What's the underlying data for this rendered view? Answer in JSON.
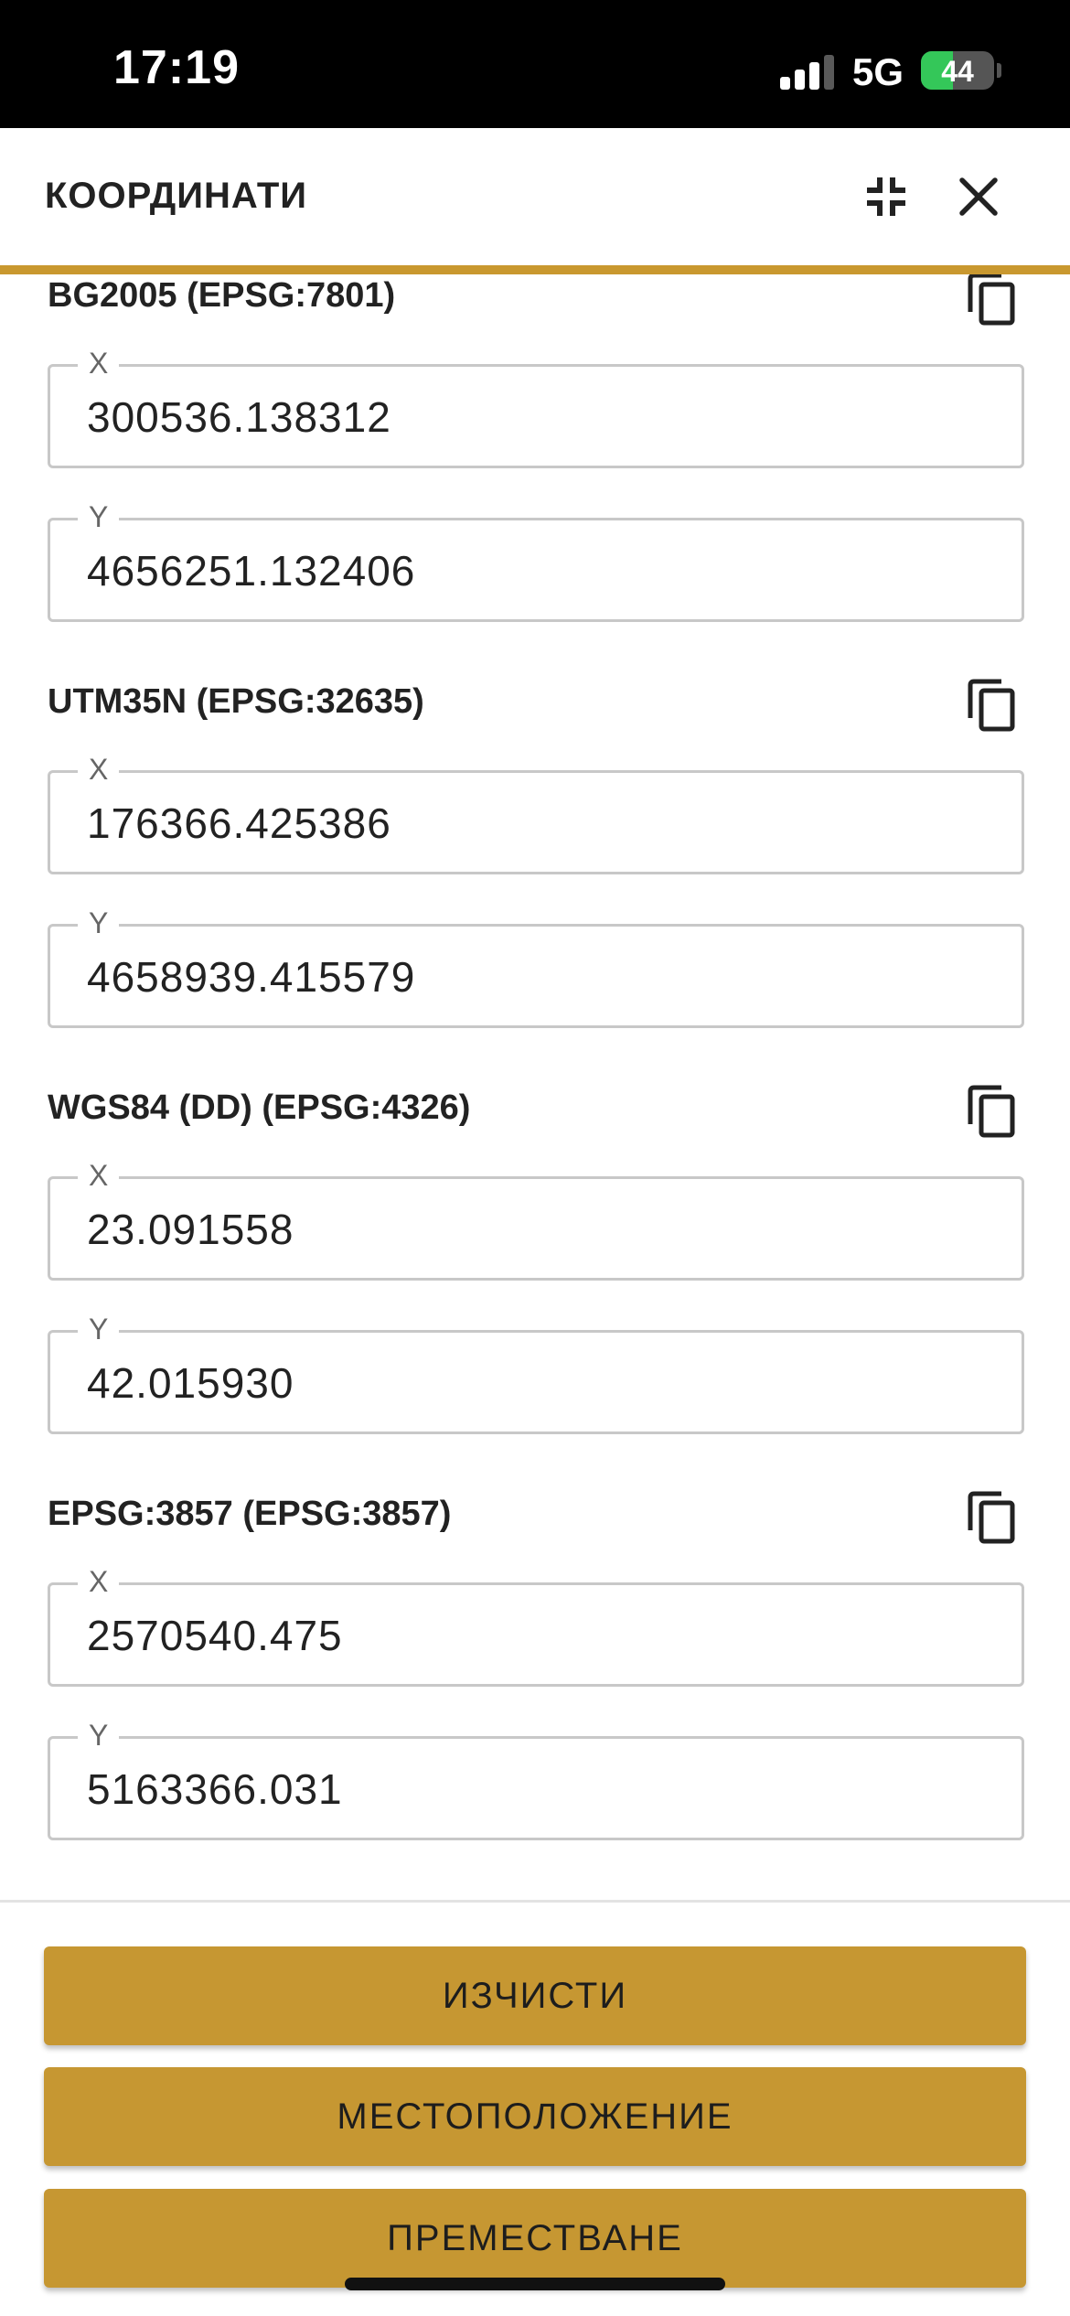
{
  "status_bar": {
    "time": "17:19",
    "network": "5G",
    "battery_percent": "44",
    "battery_level": 0.44,
    "signal_bars_active": 3,
    "signal_bars_total": 4
  },
  "header": {
    "title": "КООРДИНАТИ",
    "collapse_icon": "collapse-icon",
    "close_icon": "close-icon"
  },
  "sections": [
    {
      "title": "BG2005 (EPSG:7801)",
      "x_label": "X",
      "x_value": "300536.138312",
      "y_label": "Y",
      "y_value": "4656251.132406"
    },
    {
      "title": "UTM35N (EPSG:32635)",
      "x_label": "X",
      "x_value": "176366.425386",
      "y_label": "Y",
      "y_value": "4658939.415579"
    },
    {
      "title": "WGS84 (DD) (EPSG:4326)",
      "x_label": "X",
      "x_value": "23.091558",
      "y_label": "Y",
      "y_value": "42.015930"
    },
    {
      "title": "EPSG:3857 (EPSG:3857)",
      "x_label": "X",
      "x_value": "2570540.475",
      "y_label": "Y",
      "y_value": "5163366.031"
    }
  ],
  "actions": {
    "clear_label": "ИЗЧИСТИ",
    "location_label": "МЕСТОПОЛОЖЕНИЕ",
    "move_label": "ПРЕМЕСТВАНЕ"
  },
  "colors": {
    "accent": "#c69732",
    "header_rule": "#c9982f",
    "field_border": "#c8c8c8",
    "status_bar": "#000000",
    "battery_green": "#34c759"
  }
}
